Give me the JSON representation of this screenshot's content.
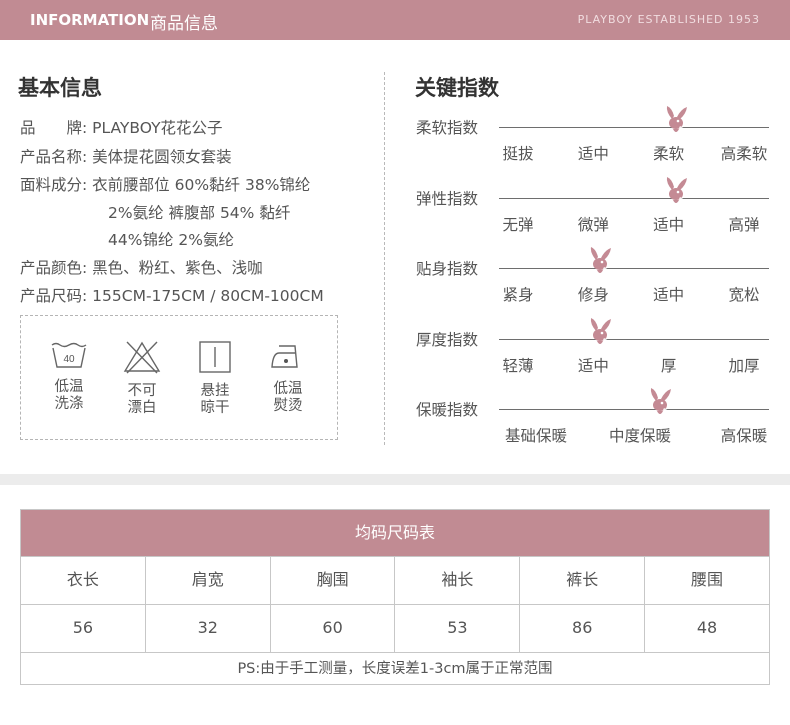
{
  "header": {
    "title_en": "INFORMATION",
    "title_cn": "商品信息",
    "tagline": "PLAYBOY ESTABLISHED 1953"
  },
  "basic_info": {
    "title": "基本信息",
    "brand_label": "品　　牌:",
    "brand": "PLAYBOY花花公子",
    "name_label": "产品名称:",
    "name": "美体提花圆领女套装",
    "fabric_label": "面料成分:",
    "fabric_line1": "衣前腰部位 60%黏纤 38%锦纶",
    "fabric_line2": "2%氨纶 裤腹部 54% 黏纤",
    "fabric_line3": "44%锦纶 2%氨纶",
    "color_label": "产品颜色:",
    "colors": "黑色、粉红、紫色、浅咖",
    "size_label": "产品尺码:",
    "sizes": "155CM-175CM / 80CM-100CM"
  },
  "care": [
    {
      "icon": "wash-40-icon",
      "symbol_text": "40",
      "label1": "低温",
      "label2": "洗涤"
    },
    {
      "icon": "no-bleach-icon",
      "label1": "不可",
      "label2": "漂白"
    },
    {
      "icon": "hang-dry-icon",
      "label1": "悬挂",
      "label2": "晾干"
    },
    {
      "icon": "low-iron-icon",
      "label1": "低温",
      "label2": "熨烫"
    }
  ],
  "key_index": {
    "title": "关键指数",
    "rows": [
      {
        "label": "柔软指数",
        "options": [
          "挺拔",
          "适中",
          "柔软",
          "高柔软"
        ],
        "selected": 2
      },
      {
        "label": "弹性指数",
        "options": [
          "无弹",
          "微弹",
          "适中",
          "高弹"
        ],
        "selected": 2
      },
      {
        "label": "贴身指数",
        "options": [
          "紧身",
          "修身",
          "适中",
          "宽松"
        ],
        "selected": 1
      },
      {
        "label": "厚度指数",
        "options": [
          "轻薄",
          "适中",
          "厚",
          "加厚"
        ],
        "selected": 1
      },
      {
        "label": "保暖指数",
        "options": [
          "基础保暖",
          "中度保暖",
          "高保暖"
        ],
        "selected": 1
      }
    ]
  },
  "size_table": {
    "title": "均码尺码表",
    "headers": [
      "衣长",
      "肩宽",
      "胸围",
      "袖长",
      "裤长",
      "腰围"
    ],
    "values": [
      "56",
      "32",
      "60",
      "53",
      "86",
      "48"
    ],
    "note": "PS:由于手工测量，长度误差1-3cm属于正常范围"
  },
  "colors": {
    "brand_pink": "#c18b93",
    "bunny": "#c48a94"
  }
}
